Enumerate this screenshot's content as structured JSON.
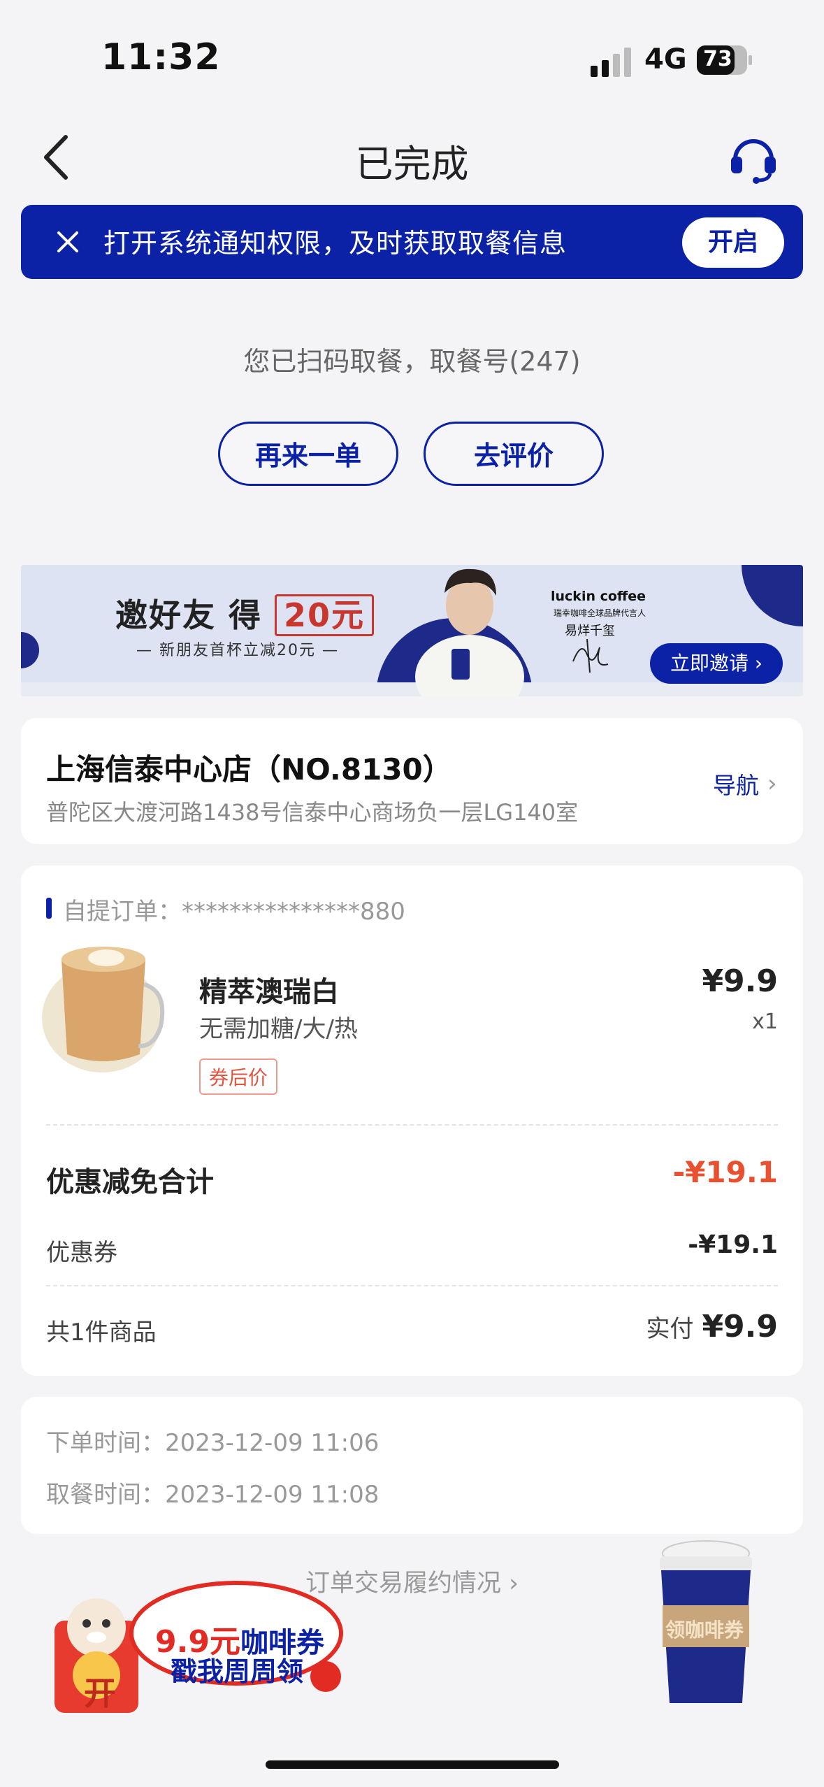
{
  "status": {
    "time": "11:32",
    "network": "4G",
    "battery": "73"
  },
  "nav": {
    "title": "已完成"
  },
  "notice": {
    "text": "打开系统通知权限，及时获取取餐信息",
    "button": "开启"
  },
  "pickup": {
    "message": "您已扫码取餐，取餐号(247)"
  },
  "actions": {
    "reorder": "再来一单",
    "review": "去评价"
  },
  "promo": {
    "title_prefix": "邀好友 得",
    "amount": "20元",
    "subtitle": "— 新朋友首杯立减20元 —",
    "brand": "luckin coffee",
    "brand_sub": "瑞幸咖啡全球品牌代言人",
    "ambassador": "易烊千玺",
    "button": "立即邀请 ›"
  },
  "store": {
    "name": "上海信泰中心店（NO.8130）",
    "address": "普陀区大渡河路1438号信泰中心商场负一层LG140室",
    "nav_label": "导航"
  },
  "order": {
    "label": "自提订单：***************880",
    "item": {
      "name": "精萃澳瑞白",
      "spec": "无需加糖/大/热",
      "tag": "券后价",
      "price": "¥9.9",
      "qty": "x1"
    },
    "discount_label": "优惠减免合计",
    "discount_total": "-¥19.1",
    "coupon_label": "优惠券",
    "coupon_value": "-¥19.1",
    "count_label": "共1件商品",
    "paid_label": "实付",
    "paid_value": "¥9.9"
  },
  "times": {
    "order_time": "下单时间：2023-12-09 11:06",
    "pickup_time": "取餐时间：2023-12-09 11:08"
  },
  "fulfillment": {
    "link": "订单交易履约情况 ›"
  },
  "floating": {
    "left_line1_price": "9.9元",
    "left_line1_rest": "咖啡券",
    "left_line2": "戳我周周领",
    "left_badge": "开",
    "right_label": "领咖啡券"
  },
  "colors": {
    "brand_blue": "#0c22a6",
    "discount_red": "#e8502f"
  }
}
